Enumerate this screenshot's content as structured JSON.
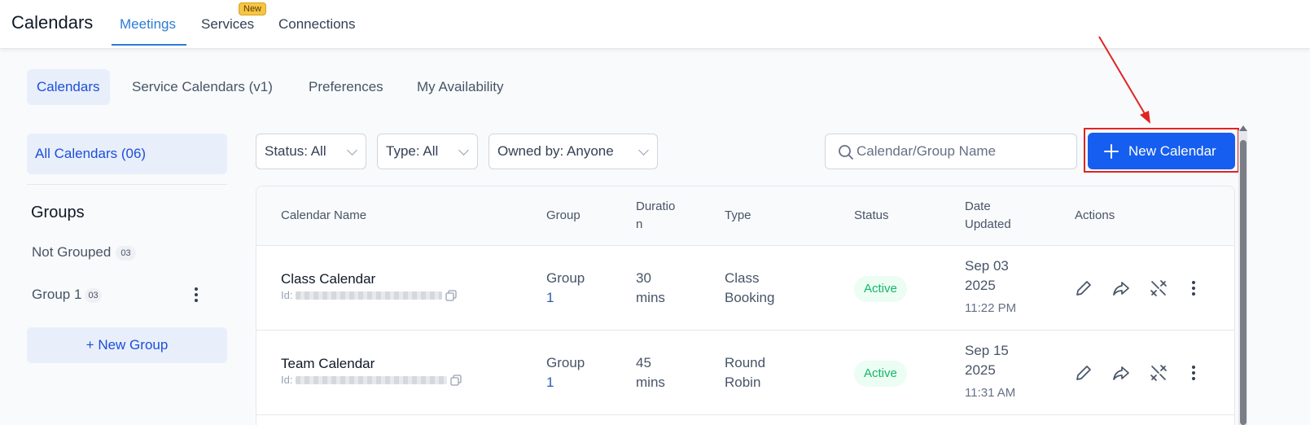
{
  "app": {
    "title": "Calendars"
  },
  "top_tabs": [
    {
      "label": "Meetings",
      "active": true
    },
    {
      "label": "Services",
      "badge": "New"
    },
    {
      "label": "Connections"
    }
  ],
  "sub_tabs": [
    {
      "label": "Calendars",
      "active": true
    },
    {
      "label": "Service Calendars (v1)"
    },
    {
      "label": "Preferences"
    },
    {
      "label": "My Availability"
    }
  ],
  "sidebar": {
    "all_calendars": "All Calendars (06)",
    "groups_title": "Groups",
    "groups": [
      {
        "label": "Not Grouped",
        "count": "03"
      },
      {
        "label": "Group 1",
        "count": "03"
      }
    ],
    "new_group": "+ New Group"
  },
  "filters": {
    "status": "Status: All",
    "type": "Type: All",
    "owned_by": "Owned by: Anyone"
  },
  "search": {
    "placeholder": "Calendar/Group Name",
    "icon": "search-icon"
  },
  "new_calendar_button": {
    "label": "New Calendar",
    "icon": "plus-icon"
  },
  "table": {
    "headers": {
      "name": "Calendar Name",
      "group": "Group",
      "duration_1": "Duratio",
      "duration_2": "n",
      "type": "Type",
      "status": "Status",
      "date_1": "Date",
      "date_2": "Updated",
      "actions": "Actions"
    },
    "rows": [
      {
        "name": "Class Calendar",
        "id_label": "Id:",
        "group_1": "Group",
        "group_2": "1",
        "duration_1": "30",
        "duration_2": "mins",
        "type_1": "Class",
        "type_2": "Booking",
        "status": "Active",
        "date_1": "Sep 03",
        "date_2": "2025",
        "time": "11:22 PM"
      },
      {
        "name": "Team Calendar",
        "id_label": "Id:",
        "group_1": "Group",
        "group_2": "1",
        "duration_1": "45",
        "duration_2": "mins",
        "type_1": "Round",
        "type_2": "Robin",
        "status": "Active",
        "date_1": "Sep 15",
        "date_2": "2025",
        "time": "11:31 AM"
      }
    ]
  },
  "colors": {
    "primary": "#155eef",
    "accent_tab": "#2e7bd6",
    "active_green": "#12b76a",
    "highlight_red": "#e02424"
  }
}
